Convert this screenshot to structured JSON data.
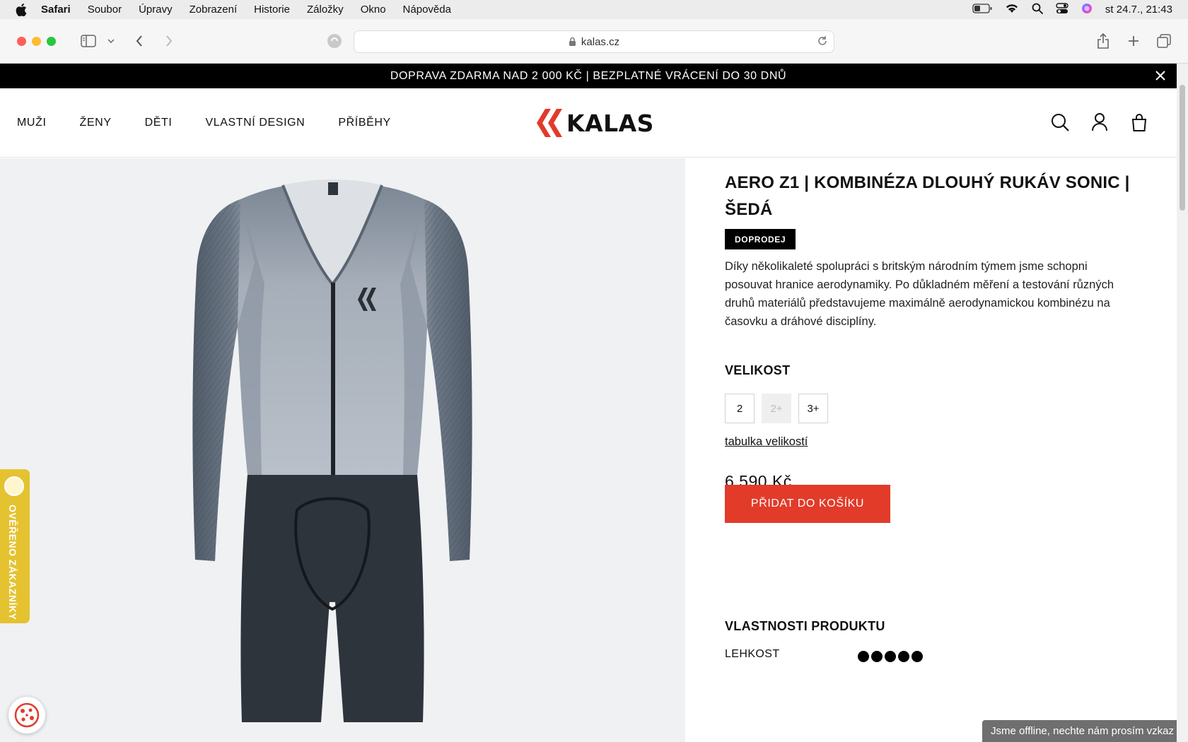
{
  "menubar": {
    "app": "Safari",
    "items": [
      "Soubor",
      "Úpravy",
      "Zobrazení",
      "Historie",
      "Záložky",
      "Okno",
      "Nápověda"
    ],
    "datetime": "st 24.7., 21:43"
  },
  "browser": {
    "url": "kalas.cz"
  },
  "promo": {
    "text": "DOPRAVA ZDARMA NAD 2 000 KČ | BEZPLATNÉ VRÁCENÍ DO 30 DNŮ"
  },
  "nav": {
    "items": [
      "MUŽI",
      "ŽENY",
      "DĚTI",
      "VLASTNÍ DESIGN",
      "PŘÍBĚHY"
    ]
  },
  "logo": {
    "text": "KALAS",
    "brand_color": "#e23b2a"
  },
  "trust_badge": {
    "text": "OVĚŘENO ZÁKAZNÍKY",
    "color": "#e5c230"
  },
  "product": {
    "title": "AERO Z1 | KOMBINÉZA DLOUHÝ RUKÁV SONIC | ŠEDÁ",
    "badge": "DOPRODEJ",
    "description": "Díky několikaleté spolupráci s britským národním týmem jsme schopni posouvat hranice aerodynamiky. Po důkladném měření a testování různých druhů materiálů představujeme maximálně aerodynamickou kombinézu na časovku a dráhové disciplíny.",
    "size_heading": "VELIKOST",
    "sizes": [
      {
        "label": "2",
        "available": true
      },
      {
        "label": "2+",
        "available": false
      },
      {
        "label": "3+",
        "available": true
      }
    ],
    "size_chart_link": "tabulka velikostí",
    "price": "6 590 Kč",
    "add_to_cart": "PŘIDAT DO KOŠÍKU",
    "properties_heading": "VLASTNOSTI PRODUKTU",
    "properties": [
      {
        "label": "LEHKOST",
        "rating": 5,
        "max": 5
      }
    ]
  },
  "chat": {
    "text": "Jsme offline, nechte nám prosím vzkaz"
  }
}
